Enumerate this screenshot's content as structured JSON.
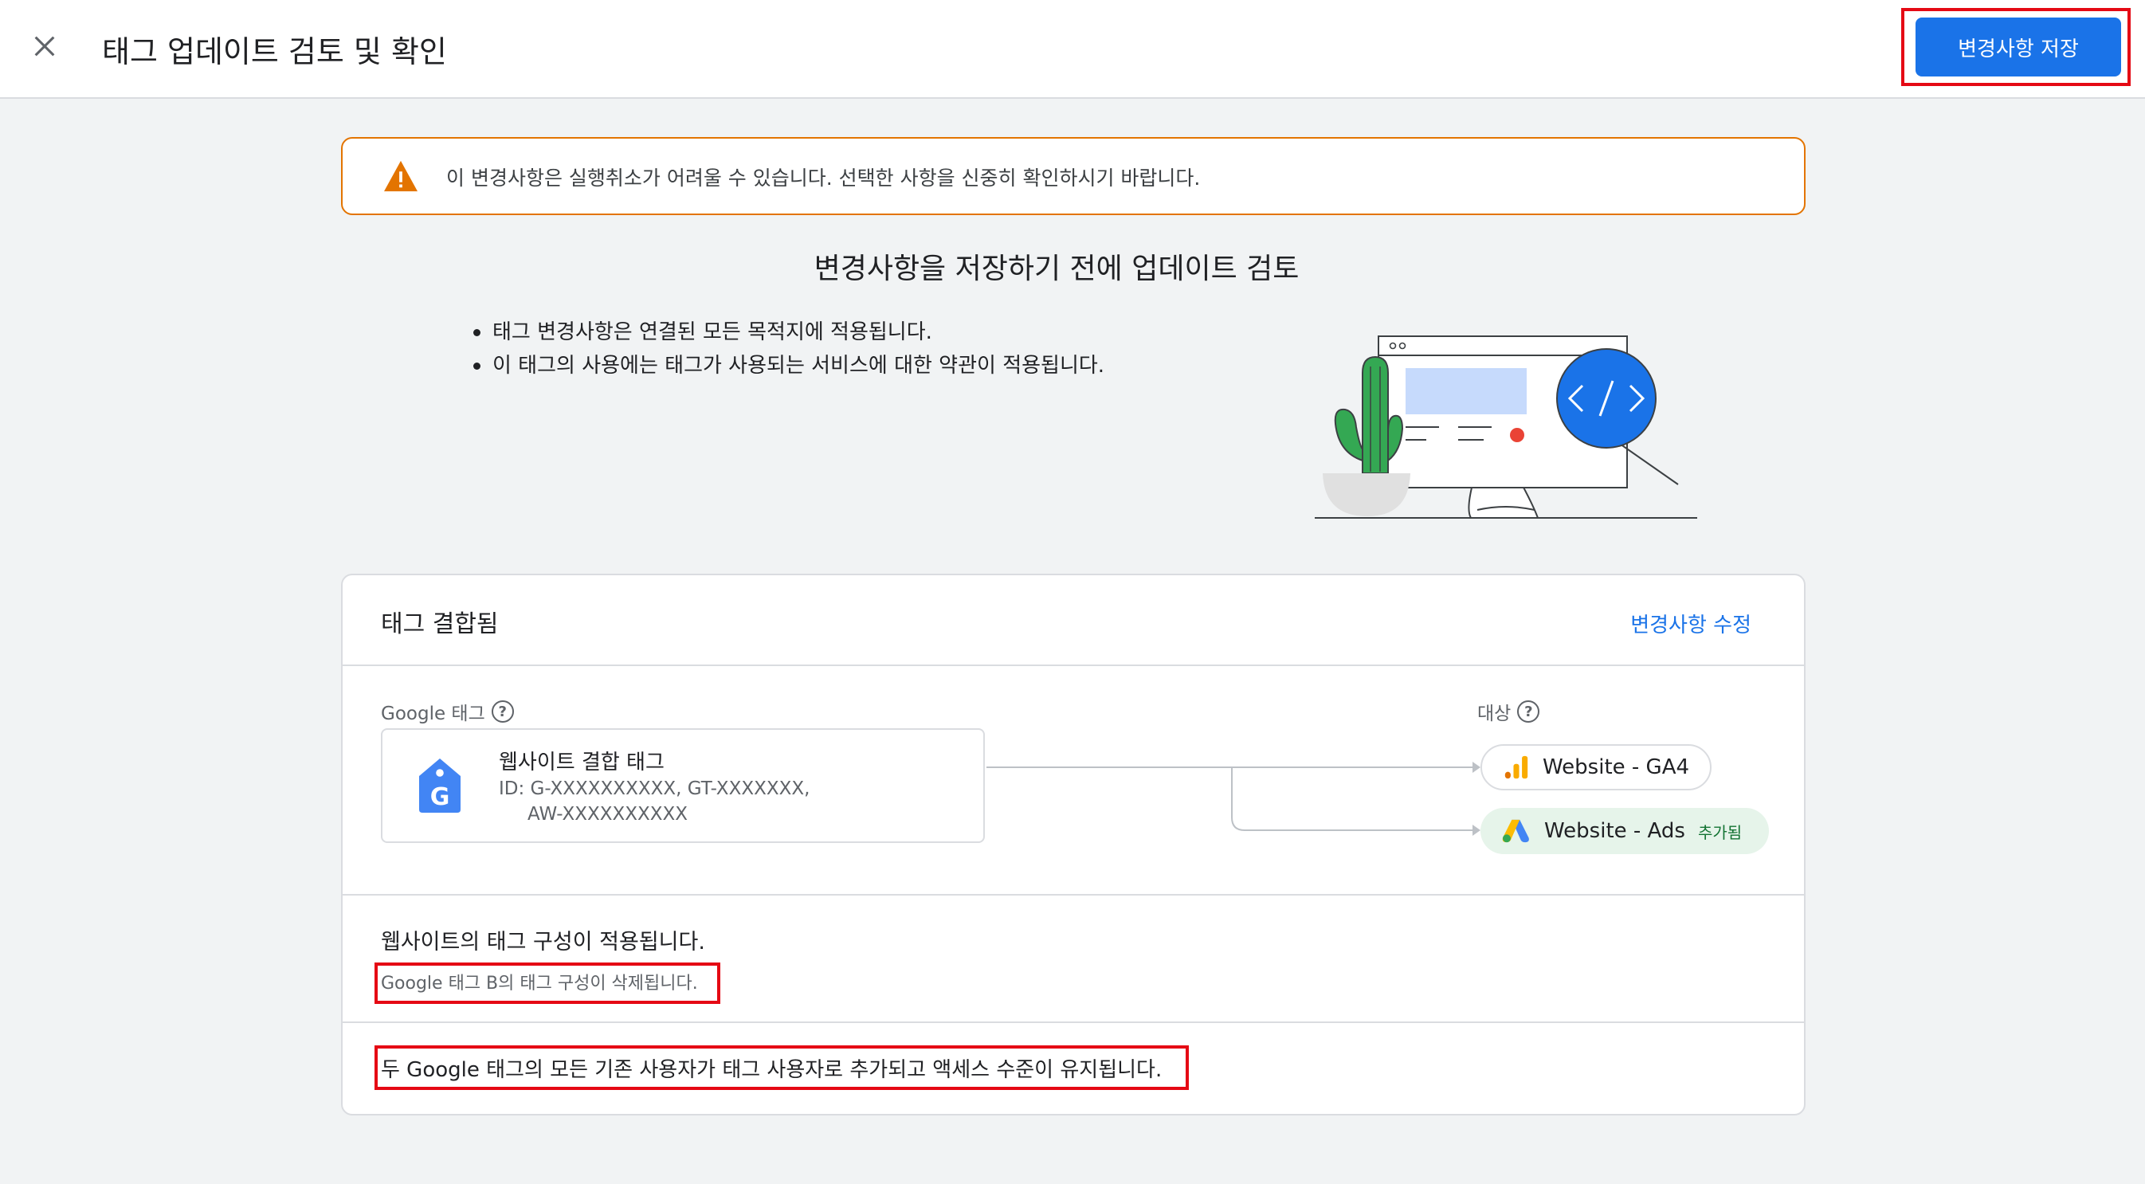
{
  "header": {
    "title": "태그 업데이트 검토 및 확인",
    "save_label": "변경사항 저장"
  },
  "warning": {
    "text": "이 변경사항은 실행취소가 어려울 수 있습니다. 선택한 사항을 신중히 확인하시기 바랍니다.",
    "color": "#e37400"
  },
  "review": {
    "heading": "변경사항을 저장하기 전에 업데이트 검토",
    "bullets": [
      "태그 변경사항은 연결된 모든 목적지에 적용됩니다.",
      "이 태그의 사용에는 태그가 사용되는 서비스에 대한 약관이 적용됩니다."
    ]
  },
  "card": {
    "title": "태그 결합됨",
    "edit_label": "변경사항 수정",
    "source_label": "Google 태그",
    "destination_label": "대상",
    "help_glyph": "?",
    "tag": {
      "name": "웹사이트 결합 태그",
      "ids_line1": "ID: G-XXXXXXXXXX, GT-XXXXXXX,",
      "ids_line2": "AW-XXXXXXXXXX",
      "icon": "google-tag-icon"
    },
    "destinations": [
      {
        "name": "Website - GA4",
        "icon": "analytics-icon",
        "badge": ""
      },
      {
        "name": "Website - Ads",
        "icon": "google-ads-icon",
        "badge": "추가됨"
      }
    ],
    "applied_text": "웹사이트의 태그 구성이 적용됩니다.",
    "deleted_note": "Google 태그 B의 태그 구성이 삭제됩니다.",
    "users_note": "두 Google 태그의 모든 기존 사용자가 태그 사용자로 추가되고 액세스 수준이 유지됩니다."
  },
  "colors": {
    "primary": "#1a73e8",
    "highlight": "#e50914",
    "added_bg": "#e6f4ea"
  }
}
